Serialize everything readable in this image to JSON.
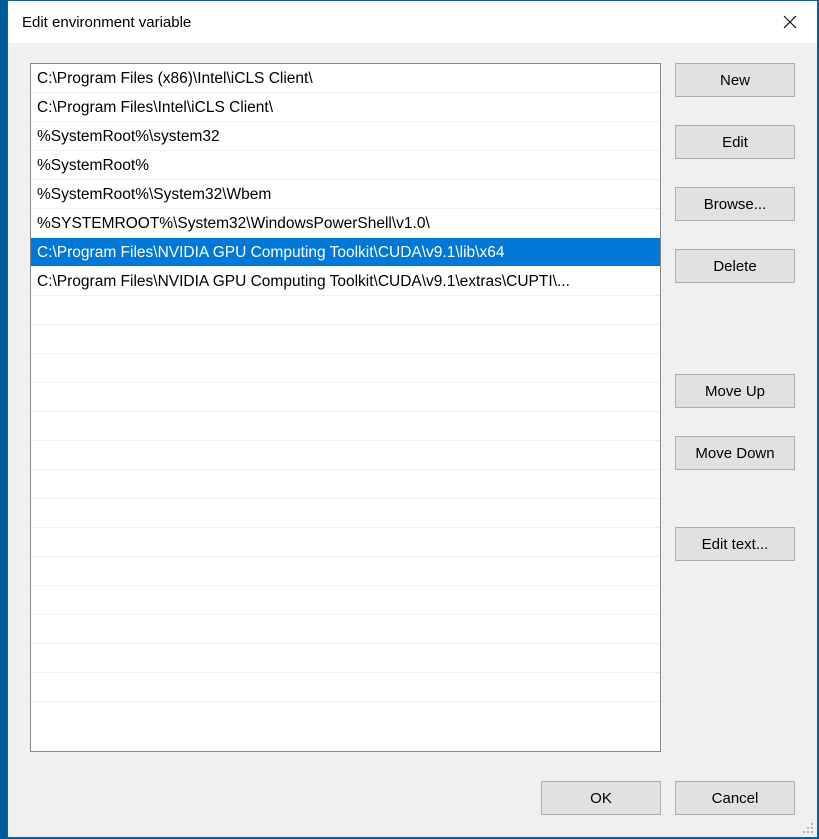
{
  "window": {
    "title": "Edit environment variable"
  },
  "list": {
    "items": [
      {
        "text": "C:\\Program Files (x86)\\Intel\\iCLS Client\\",
        "selected": false
      },
      {
        "text": "C:\\Program Files\\Intel\\iCLS Client\\",
        "selected": false
      },
      {
        "text": "%SystemRoot%\\system32",
        "selected": false
      },
      {
        "text": "%SystemRoot%",
        "selected": false
      },
      {
        "text": "%SystemRoot%\\System32\\Wbem",
        "selected": false
      },
      {
        "text": "%SYSTEMROOT%\\System32\\WindowsPowerShell\\v1.0\\",
        "selected": false
      },
      {
        "text": "C:\\Program Files\\NVIDIA GPU Computing Toolkit\\CUDA\\v9.1\\lib\\x64",
        "selected": true
      },
      {
        "text": "C:\\Program Files\\NVIDIA GPU Computing Toolkit\\CUDA\\v9.1\\extras\\CUPTI\\...",
        "selected": false
      }
    ],
    "blank_rows": 14
  },
  "buttons": {
    "new": "New",
    "edit": "Edit",
    "browse": "Browse...",
    "delete": "Delete",
    "move_up": "Move Up",
    "move_down": "Move Down",
    "edit_text": "Edit text...",
    "ok": "OK",
    "cancel": "Cancel"
  }
}
